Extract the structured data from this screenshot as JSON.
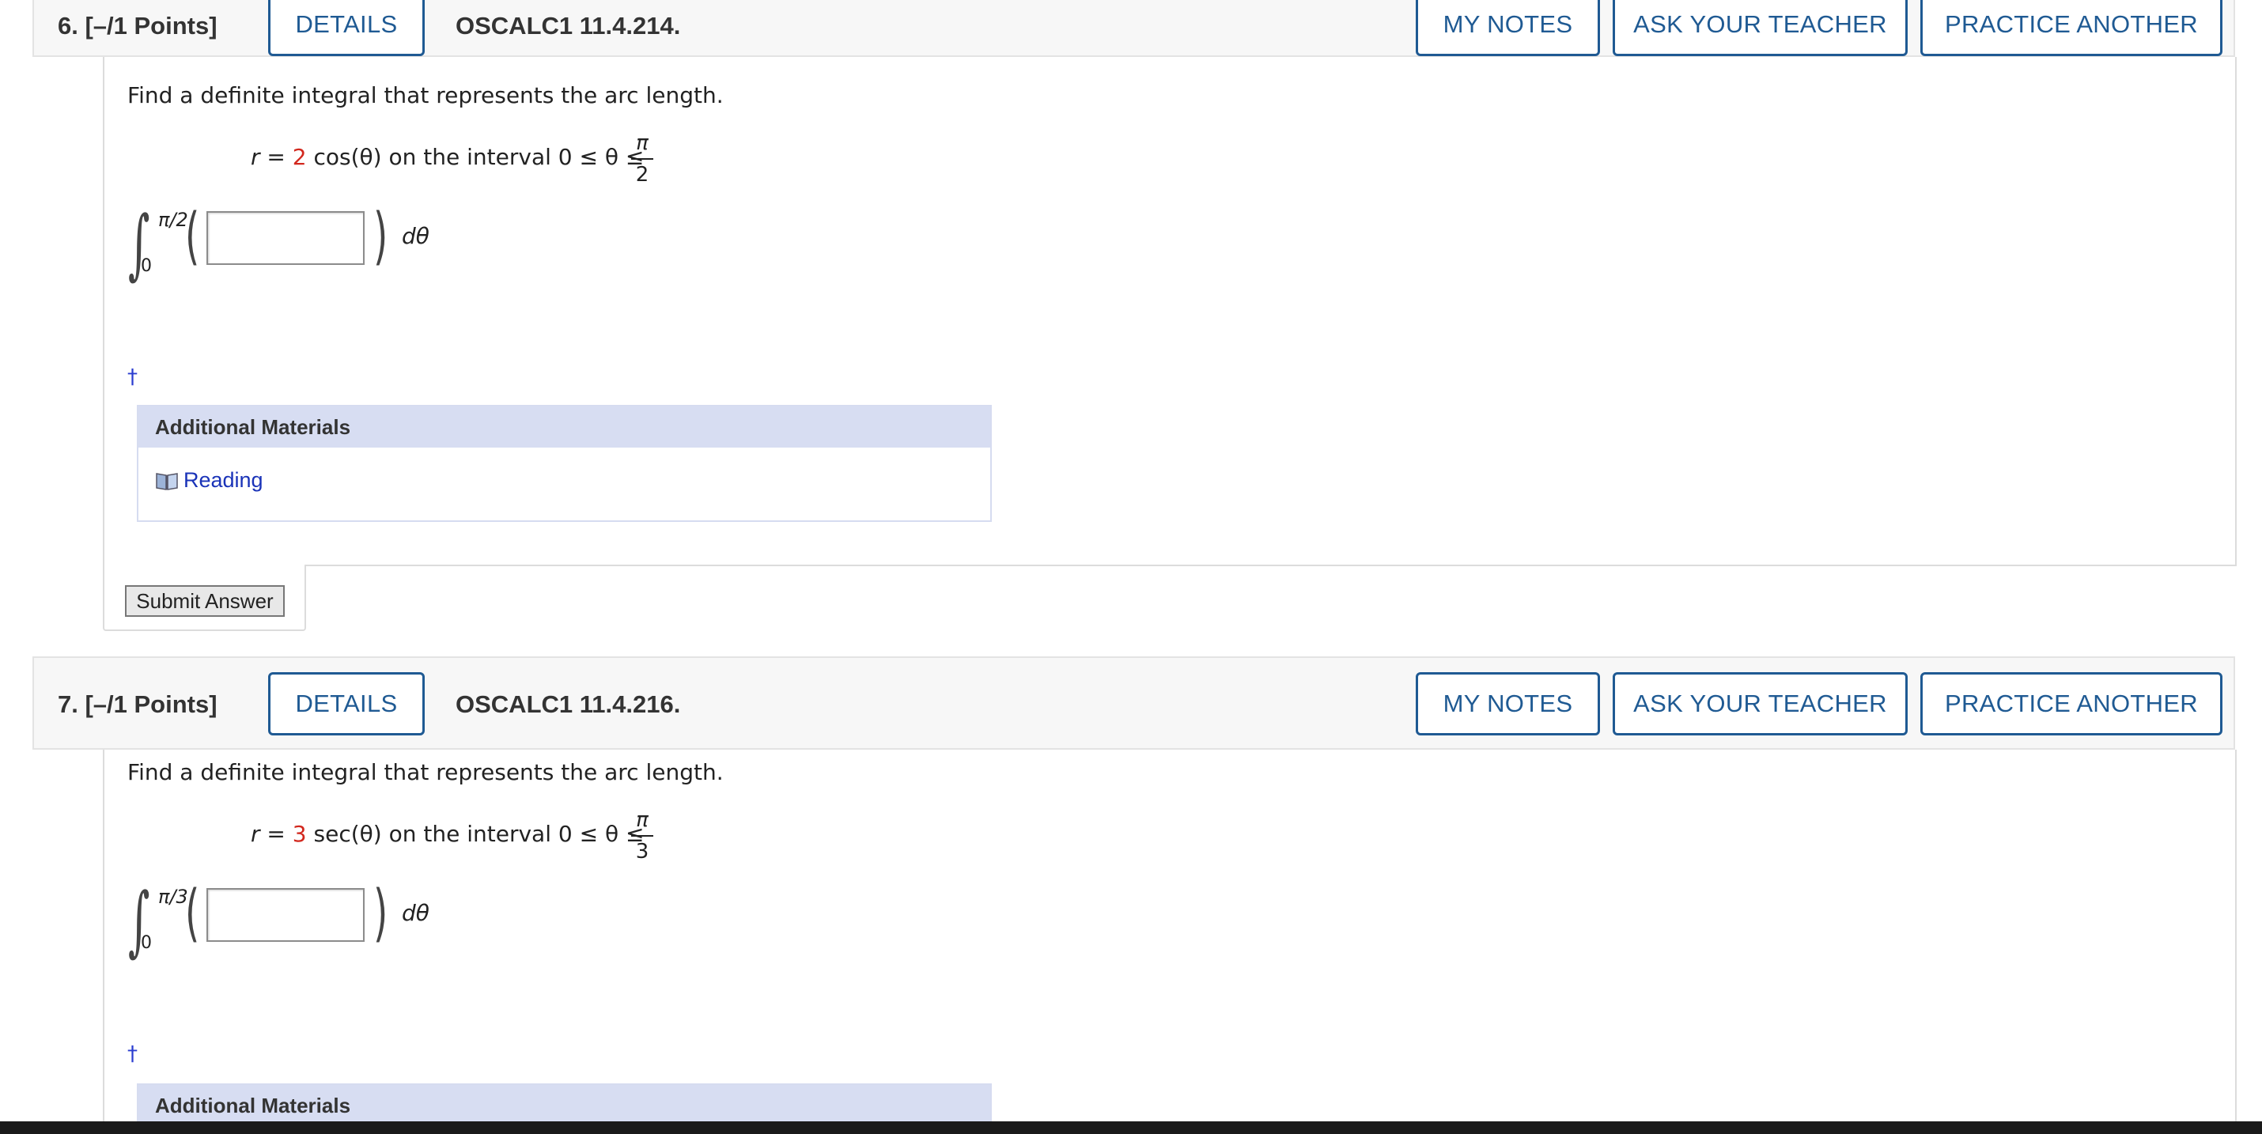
{
  "questions": [
    {
      "label": "6.  [–/1 Points]",
      "details": "DETAILS",
      "code": "OSCALC1 11.4.214.",
      "my_notes": "MY NOTES",
      "ask_teacher": "ASK YOUR TEACHER",
      "practice": "PRACTICE ANOTHER",
      "prompt": "Find a definite integral that represents the arc length.",
      "eq_r": "r =",
      "eq_coef": "2",
      "eq_func": "cos(θ) on the interval 0 ≤ θ ≤",
      "frac_num": "π",
      "frac_den": "2",
      "int_upper": "π/2",
      "int_lower": "0",
      "dtheta": "dθ",
      "dagger": "†",
      "answer_value": "",
      "additional_materials": "Additional Materials",
      "reading": "Reading",
      "submit": "Submit Answer"
    },
    {
      "label": "7.  [–/1 Points]",
      "details": "DETAILS",
      "code": "OSCALC1 11.4.216.",
      "my_notes": "MY NOTES",
      "ask_teacher": "ASK YOUR TEACHER",
      "practice": "PRACTICE ANOTHER",
      "prompt": "Find a definite integral that represents the arc length.",
      "eq_r": "r =",
      "eq_coef": "3",
      "eq_func": "sec(θ) on the interval 0 ≤ θ ≤",
      "frac_num": "π",
      "frac_den": "3",
      "int_upper": "π/3",
      "int_lower": "0",
      "dtheta": "dθ",
      "dagger": "†",
      "answer_value": "",
      "additional_materials": "Additional Materials"
    }
  ],
  "colors": {
    "accent": "#1f5a93",
    "highlight": "#d2281e",
    "link": "#1a33b8",
    "materials_header": "#d7ddf2"
  },
  "icons": {
    "reading": "book-icon"
  }
}
